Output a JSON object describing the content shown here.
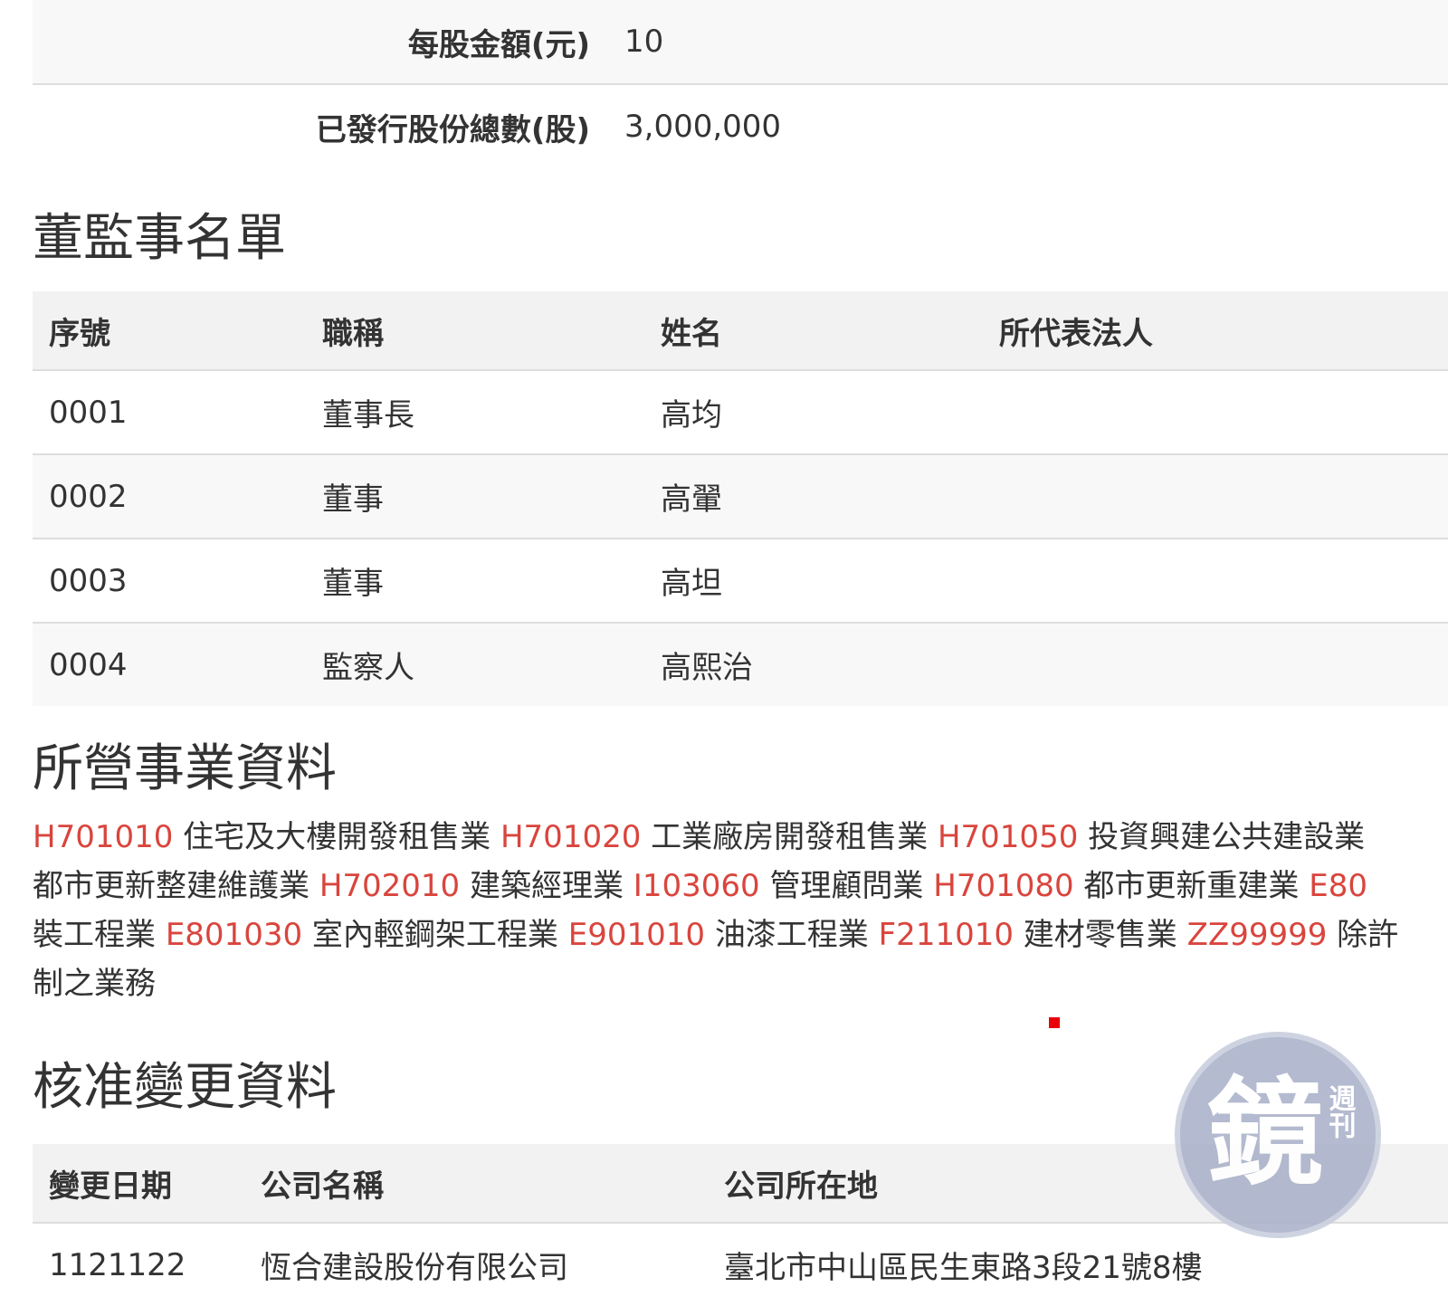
{
  "capital": {
    "par_value_label": "每股金額(元)",
    "par_value": "10",
    "total_shares_label": "已發行股份總數(股)",
    "total_shares": "3,000,000"
  },
  "directors": {
    "title": "董監事名單",
    "headers": [
      "序號",
      "職稱",
      "姓名",
      "所代表法人"
    ],
    "rows": [
      {
        "no": "0001",
        "position": "董事長",
        "name": "高均",
        "rep": ""
      },
      {
        "no": "0002",
        "position": "董事",
        "name": "高翬",
        "rep": ""
      },
      {
        "no": "0003",
        "position": "董事",
        "name": "高坦",
        "rep": ""
      },
      {
        "no": "0004",
        "position": "監察人",
        "name": "高熙治",
        "rep": ""
      }
    ]
  },
  "business": {
    "title": "所營事業資料",
    "lines": [
      [
        {
          "code": "H701010",
          "desc": "住宅及大樓開發租售業"
        },
        {
          "code": "H701020",
          "desc": "工業廠房開發租售業"
        },
        {
          "code": "H701050",
          "desc": "投資興建公共建設業"
        }
      ],
      [
        {
          "code": "",
          "desc": "都市更新整建維護業"
        },
        {
          "code": "H702010",
          "desc": "建築經理業"
        },
        {
          "code": "I103060",
          "desc": "管理顧問業"
        },
        {
          "code": "H701080",
          "desc": "都市更新重建業"
        },
        {
          "code": "E80",
          "desc": ""
        }
      ],
      [
        {
          "code": "",
          "desc": "裝工程業"
        },
        {
          "code": "E801030",
          "desc": "室內輕鋼架工程業"
        },
        {
          "code": "E901010",
          "desc": "油漆工程業"
        },
        {
          "code": "F211010",
          "desc": "建材零售業"
        },
        {
          "code": "ZZ99999",
          "desc": "除許"
        }
      ],
      [
        {
          "code": "",
          "desc": "制之業務"
        }
      ]
    ]
  },
  "changes": {
    "title": "核准變更資料",
    "headers": [
      "變更日期",
      "公司名稱",
      "公司所在地"
    ],
    "rows": [
      {
        "date": "1121122",
        "company": "恆合建設股份有限公司",
        "address": "臺北市中山區民生東路3段21號8樓"
      }
    ]
  },
  "watermark": {
    "text": "鏡",
    "sub": "週刊"
  },
  "colors": {
    "code": "#d9453d",
    "dot": "#e8000b",
    "logo": "#aab1c9"
  }
}
